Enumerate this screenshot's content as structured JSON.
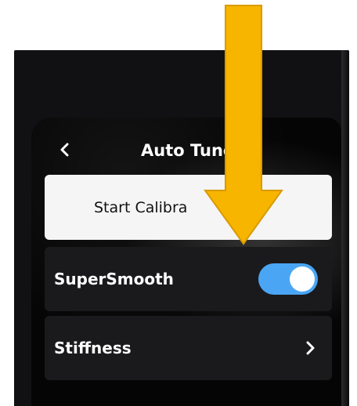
{
  "header": {
    "back_icon": "chevron-left-icon",
    "title": "Auto Tune"
  },
  "actions": {
    "start_calibration_label": "Start Calibra"
  },
  "settings": {
    "supersmooth": {
      "label": "SuperSmooth",
      "enabled": true
    },
    "stiffness": {
      "label": "Stiffness",
      "chevron_icon": "chevron-right-icon"
    }
  },
  "overlay": {
    "arrow_icon": "down-arrow-icon",
    "arrow_color": "#F7B500",
    "toggle_color": "#4AA6F5"
  }
}
